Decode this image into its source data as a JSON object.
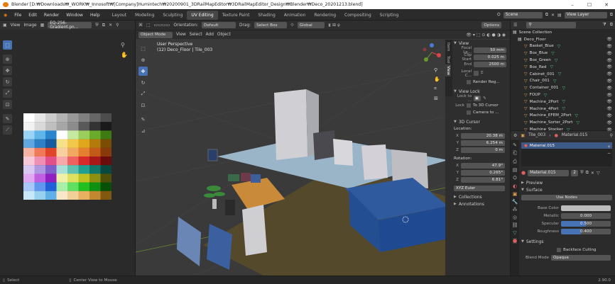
{
  "window": {
    "title": "Blender [D:₩Downloads₩_WORK₩_Innosoft₩[Company]Humintech₩20200901_3DRailMapEditor₩3DRailMapEditor_Design₩Blender₩Deco_20201213.blend]"
  },
  "menu": [
    "File",
    "Edit",
    "Render",
    "Window",
    "Help"
  ],
  "workspaces": [
    "Layout",
    "Modeling",
    "Sculpting",
    "UV Editing",
    "Texture Paint",
    "Shading",
    "Animation",
    "Rendering",
    "Compositing",
    "Scripting"
  ],
  "active_workspace": "UV Editing",
  "scene": {
    "label": "Scene",
    "view_layer": "View Layer"
  },
  "image_editor": {
    "view": "View",
    "image": "Image",
    "image_name": "EQ-256-Gradient.pn..."
  },
  "viewport": {
    "mode": "Object Mode",
    "menu": [
      "View",
      "Select",
      "Add",
      "Object"
    ],
    "orientation_label": "Orientation:",
    "orientation": "Default",
    "drag_label": "Drag:",
    "drag": "Select Box",
    "pivot": "Global",
    "options": "Options",
    "perspective": "User Perspective",
    "object_info": "(12) Deco_Floor | Tile_003",
    "tabs": [
      "Item",
      "Tool",
      "View"
    ]
  },
  "npanel": {
    "view": {
      "title": "View",
      "focal_label": "Focal Le...",
      "focal": "50 mm",
      "clip_start_label": "Clip Start",
      "clip_start": "0.025 m",
      "end_label": "End",
      "end": "2500 m",
      "local_camera_label": "Local C...",
      "render_region": "Render Reg..."
    },
    "view_lock": {
      "title": "View Lock",
      "lock_to_label": "Lock to ...",
      "lock_label": "Lock",
      "to_3d_cursor": "To 3D Cursor",
      "camera_to": "Camera to ..."
    },
    "cursor": {
      "title": "3D Cursor",
      "location_label": "Location:",
      "x": "20.38 m",
      "y": "6.254 m",
      "z": "0 m",
      "rotation_label": "Rotation:",
      "rx": "47.9°",
      "ry": "0.265°",
      "rz": "6.81°",
      "mode": "XYZ Euler"
    },
    "collections": "Collections",
    "annotations": "Annotations"
  },
  "outliner": {
    "collection": "Scene Collection",
    "items": [
      "Deco_Floor",
      "Basket_Blue",
      "Box_Blue",
      "Box_Green",
      "Box_Red",
      "Cabinet_001",
      "Chair_001",
      "Container_001",
      "FOUP",
      "Machine_2Port",
      "Machine_4Port",
      "Machine_EFEM_2Port",
      "Machine_Sorter_2Port",
      "Machine_Stocker"
    ]
  },
  "properties": {
    "object": "Tile_003",
    "material_slot": "Material.015",
    "material_list_item": "Material.015",
    "material_name": "Material.015",
    "users": "2",
    "preview": "Preview",
    "surface": "Surface",
    "use_nodes": "Use Nodes",
    "base_color_label": "Base Color",
    "metallic_label": "Metallic",
    "metallic": "0.000",
    "specular_label": "Specular",
    "specular": "0.500",
    "roughness_label": "Roughness",
    "roughness": "0.400",
    "settings": "Settings",
    "backface": "Backface Culling",
    "blend_mode_label": "Blend Mode",
    "blend_mode": "Opaque"
  },
  "status": {
    "select": "Select",
    "center": "Center View to Mouse",
    "version": "2.90.0"
  },
  "colors": {
    "accent": "#4772b3",
    "bg": "#1d1d1d",
    "panel": "#303030",
    "header": "#2b2b2b"
  }
}
